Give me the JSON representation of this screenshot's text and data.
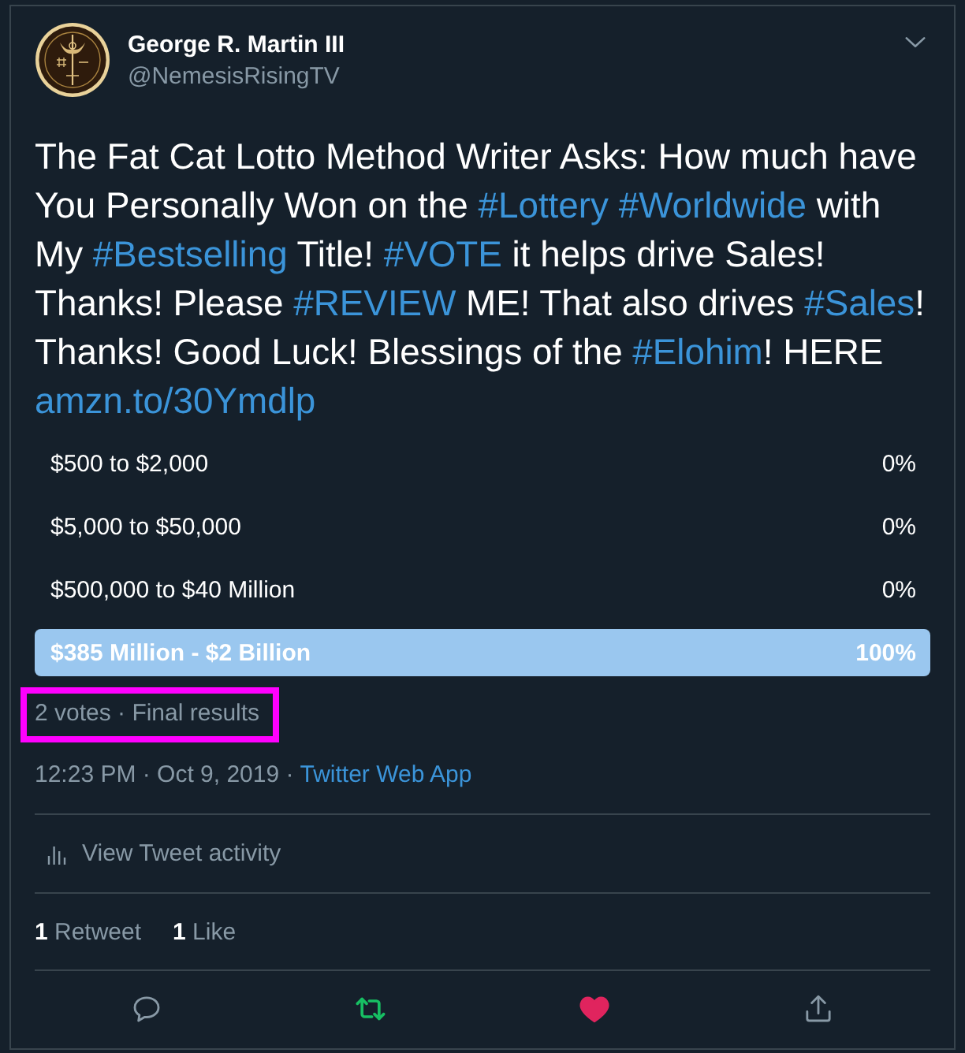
{
  "header": {
    "author_name": "George R. Martin III",
    "handle": "@NemesisRisingTV"
  },
  "tweet_text": [
    {
      "kind": "text",
      "text": "The Fat Cat Lotto Method Writer Asks: How much have You Personally Won on the "
    },
    {
      "kind": "hashtag",
      "text": "#Lottery"
    },
    {
      "kind": "hashtag",
      "text": "#Worldwide"
    },
    {
      "kind": "text",
      "text": " with My "
    },
    {
      "kind": "hashtag",
      "text": "#Bestselling"
    },
    {
      "kind": "text",
      "text": " Title! "
    },
    {
      "kind": "hashtag",
      "text": "#VOTE"
    },
    {
      "kind": "text",
      "text": " it helps drive Sales! Thanks! Please "
    },
    {
      "kind": "hashtag",
      "text": "#REVIEW"
    },
    {
      "kind": "text",
      "text": " ME! That also drives "
    },
    {
      "kind": "hashtag",
      "text": "#Sales"
    },
    {
      "kind": "text",
      "text": "! Thanks! Good Luck! Blessings of the "
    },
    {
      "kind": "hashtag",
      "text": "#Elohim"
    },
    {
      "kind": "text",
      "text": "! HERE "
    },
    {
      "kind": "link",
      "text": "amzn.to/30Ymdlp"
    }
  ],
  "poll": {
    "options": [
      {
        "label": "$500 to $2,000",
        "percent": "0%",
        "winner": false
      },
      {
        "label": "$5,000 to $50,000",
        "percent": "0%",
        "winner": false
      },
      {
        "label": "$500,000 to $40 Million",
        "percent": "0%",
        "winner": false
      },
      {
        "label": "$385 Million - $2 Billion",
        "percent": "100%",
        "level": 1,
        "winner": true
      }
    ],
    "summary": "2 votes · Final results",
    "summary_highlighted": true
  },
  "meta": {
    "timestamp": "12:23 PM · Oct 9, 2019 ·",
    "source": "Twitter Web App"
  },
  "activity": {
    "label": "View Tweet activity"
  },
  "stats": [
    {
      "count": "1",
      "label": "Retweet"
    },
    {
      "count": "1",
      "label": "Like"
    }
  ],
  "actions": [
    {
      "kind": "reply",
      "active": false
    },
    {
      "kind": "retweet",
      "active": true
    },
    {
      "kind": "like",
      "active": true
    },
    {
      "kind": "share",
      "active": false
    }
  ]
}
